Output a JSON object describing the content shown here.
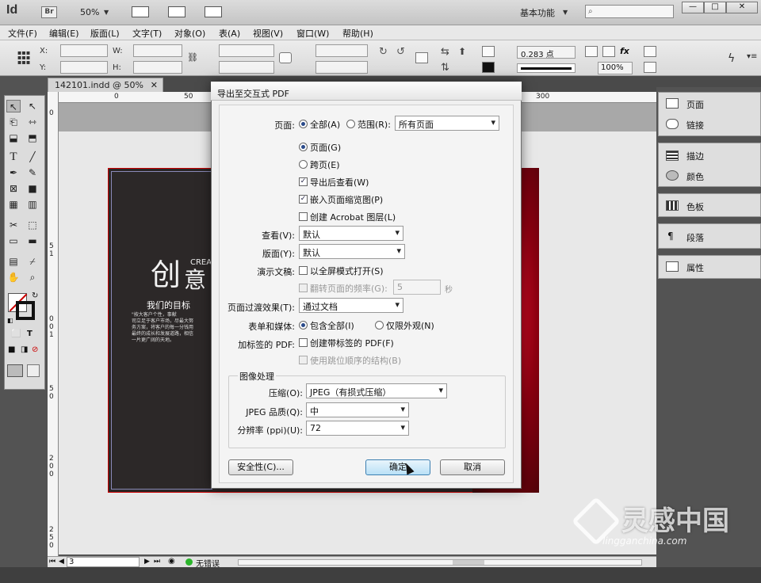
{
  "app": {
    "logo": "Id",
    "bridge": "Br",
    "zoom": "50%",
    "workspace": "基本功能",
    "window_buttons": {
      "minimize": "—",
      "restore": "□",
      "close": "✕"
    }
  },
  "menu": [
    "文件(F)",
    "编辑(E)",
    "版面(L)",
    "文字(T)",
    "对象(O)",
    "表(A)",
    "视图(V)",
    "窗口(W)",
    "帮助(H)"
  ],
  "control_panel": {
    "x_label": "X:",
    "y_label": "Y:",
    "w_label": "W:",
    "h_label": "H:",
    "stroke_weight": "0.283 点",
    "scale": "100%"
  },
  "document": {
    "tab_title": "142101.indd @ 50%",
    "ruler_h": [
      "0",
      "50",
      "300"
    ],
    "ruler_v": [
      "0",
      "5",
      "1",
      "0",
      "0",
      "1",
      "5",
      "0",
      "2",
      "0",
      "0",
      "2",
      "5",
      "0"
    ],
    "page_title_cn": "创",
    "page_title_cn2": "意",
    "page_title_en": "CREA",
    "page_goal": "我们的目标",
    "page_text": [
      "\"按大客户个性，事献",
      "司立足于客户市场，尽最大努",
      "务方案，将客户的每一分钱用",
      "最终的成长和发展道路，相信",
      "一片更广阔的天地。"
    ]
  },
  "status": {
    "page": "3",
    "errors": "无错误"
  },
  "right_panels": [
    {
      "label": "页面",
      "icon": "pages-icon"
    },
    {
      "label": "链接",
      "icon": "links-icon"
    },
    {
      "label": "描边",
      "icon": "stroke-icon"
    },
    {
      "label": "颜色",
      "icon": "color-icon"
    },
    {
      "label": "色板",
      "icon": "swatches-icon"
    },
    {
      "label": "段落",
      "icon": "paragraph-icon"
    },
    {
      "label": "属性",
      "icon": "attributes-icon"
    }
  ],
  "dialog": {
    "title": "导出至交互式 PDF",
    "pages_label": "页面:",
    "all_label": "全部(A)",
    "range_label": "范围(R):",
    "range_value": "所有页面",
    "pages_option": "页面(G)",
    "spreads_option": "跨页(E)",
    "view_after": "导出后查看(W)",
    "embed_thumbs": "嵌入页面缩览图(P)",
    "acrobat_layers": "创建 Acrobat 图层(L)",
    "view_label": "查看(V):",
    "view_value": "默认",
    "layout_label": "版面(Y):",
    "layout_value": "默认",
    "presentation_label": "演示文稿:",
    "fullscreen": "以全屏模式打开(S)",
    "flip_label": "翻转页面的频率(G):",
    "flip_value": "5",
    "flip_unit": "秒",
    "transition_label": "页面过渡效果(T):",
    "transition_value": "通过文档",
    "forms_label": "表单和媒体:",
    "include_all": "包含全部(I)",
    "appearance_only": "仅限外观(N)",
    "tagged_label": "加标签的 PDF:",
    "tagged_option": "创建带标签的 PDF(F)",
    "tab_order": "使用跳位顺序的结构(B)",
    "image_group": "图像处理",
    "compression_label": "压缩(O):",
    "compression_value": "JPEG（有损式压缩）",
    "jpeg_quality_label": "JPEG 品质(Q):",
    "jpeg_quality_value": "中",
    "resolution_label": "分辨率 (ppi)(U):",
    "resolution_value": "72",
    "security_button": "安全性(C)...",
    "ok_button": "确定",
    "cancel_button": "取消"
  },
  "watermark": {
    "name": "灵感中国",
    "url": "lingganchina.com"
  }
}
